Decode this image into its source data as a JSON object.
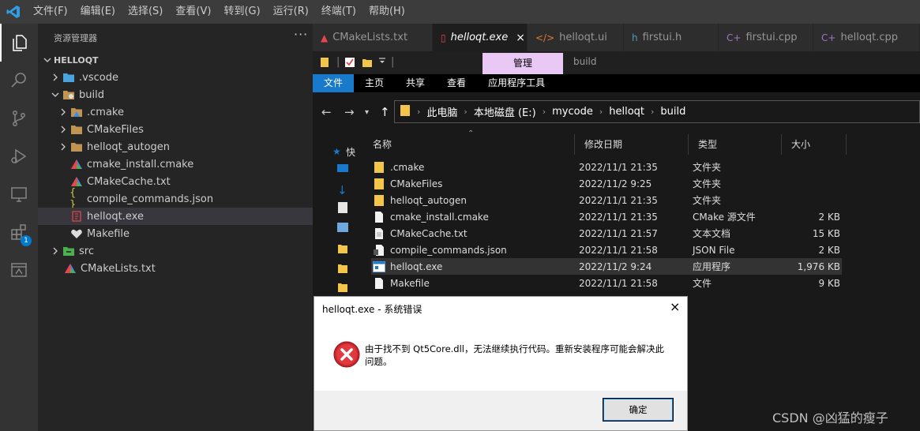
{
  "titlebar": {
    "menu": [
      "文件(F)",
      "编辑(E)",
      "选择(S)",
      "查看(V)",
      "转到(G)",
      "运行(R)",
      "终端(T)",
      "帮助(H)"
    ]
  },
  "activity": {
    "extensions_badge": "1"
  },
  "sidebar": {
    "title": "资源管理器",
    "more": "···",
    "root": "HELLOQT",
    "items": [
      {
        "label": ".vscode",
        "icon": "vscode-folder-icon"
      },
      {
        "label": "build",
        "icon": "build-folder-icon"
      },
      {
        "label": ".cmake",
        "icon": "cmake-folder-icon"
      },
      {
        "label": "CMakeFiles",
        "icon": "folder-icon"
      },
      {
        "label": "helloqt_autogen",
        "icon": "folder-icon"
      },
      {
        "label": "cmake_install.cmake",
        "icon": "cmake-icon"
      },
      {
        "label": "CMakeCache.txt",
        "icon": "cmake-icon"
      },
      {
        "label": "compile_commands.json",
        "icon": "json-icon"
      },
      {
        "label": "helloqt.exe",
        "icon": "exe-icon"
      },
      {
        "label": "Makefile",
        "icon": "makefile-icon"
      },
      {
        "label": "src",
        "icon": "src-folder-icon"
      },
      {
        "label": "CMakeLists.txt",
        "icon": "cmake-icon"
      }
    ]
  },
  "tabs": [
    {
      "label": "CMakeLists.txt",
      "icon": "▲",
      "color": "#e8454c"
    },
    {
      "label": "helloqt.exe",
      "icon": "▯",
      "color": "#e8454c"
    },
    {
      "label": "helloqt.ui",
      "icon": "</>",
      "color": "#e37933"
    },
    {
      "label": "firstui.h",
      "icon": "h",
      "color": "#519aba"
    },
    {
      "label": "firstui.cpp",
      "icon": "C+",
      "color": "#a074c4"
    },
    {
      "label": "helloqt.cpp",
      "icon": "C+",
      "color": "#a074c4"
    }
  ],
  "tab_close": "×",
  "explorer": {
    "manage": "管理",
    "build_caption": "build",
    "ribbon": [
      "文件",
      "主页",
      "共享",
      "查看",
      "应用程序工具"
    ],
    "breadcrumb": [
      "此电脑",
      "本地磁盘 (E:)",
      "mycode",
      "helloqt",
      "build"
    ],
    "nav_quick": "快",
    "columns": [
      "名称",
      "修改日期",
      "类型",
      "大小"
    ],
    "files": [
      {
        "name": ".cmake",
        "date": "2022/11/1 21:35",
        "type": "文件夹",
        "size": ""
      },
      {
        "name": "CMakeFiles",
        "date": "2022/11/2 9:25",
        "type": "文件夹",
        "size": ""
      },
      {
        "name": "helloqt_autogen",
        "date": "2022/11/1 21:35",
        "type": "文件夹",
        "size": ""
      },
      {
        "name": "cmake_install.cmake",
        "date": "2022/11/1 21:35",
        "type": "CMake 源文件",
        "size": "2 KB"
      },
      {
        "name": "CMakeCache.txt",
        "date": "2022/11/1 21:57",
        "type": "文本文档",
        "size": "15 KB"
      },
      {
        "name": "compile_commands.json",
        "date": "2022/11/1 21:58",
        "type": "JSON File",
        "size": "2 KB"
      },
      {
        "name": "helloqt.exe",
        "date": "2022/11/2 9:24",
        "type": "应用程序",
        "size": "1,976 KB"
      },
      {
        "name": "Makefile",
        "date": "2022/11/1 21:58",
        "type": "文件",
        "size": "9 KB"
      }
    ]
  },
  "dialog": {
    "title": "helloqt.exe - 系统错误",
    "close": "×",
    "message": "由于找不到 Qt5Core.dll，无法继续执行代码。重新安装程序可能会解决此问题。",
    "ok": "确定"
  },
  "watermark": "CSDN @凶猛的瘦子"
}
